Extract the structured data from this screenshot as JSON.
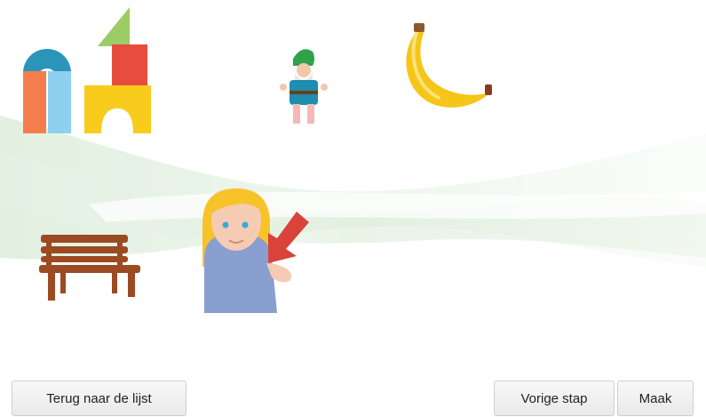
{
  "scene": {
    "objects": [
      {
        "name": "blocks-icon"
      },
      {
        "name": "gnome-icon"
      },
      {
        "name": "banana-icon"
      },
      {
        "name": "bench-icon"
      },
      {
        "name": "girl-icon"
      },
      {
        "name": "arrow-icon"
      }
    ],
    "colors": {
      "background": "#ffffff",
      "wave": "#e3f1e3",
      "arrow": "#d9433a",
      "banana": "#f5c518",
      "bench": "#9b4a22"
    }
  },
  "buttons": {
    "back_label": "Terug naar de lijst",
    "prev_label": "Vorige stap",
    "make_label": "Maak"
  }
}
